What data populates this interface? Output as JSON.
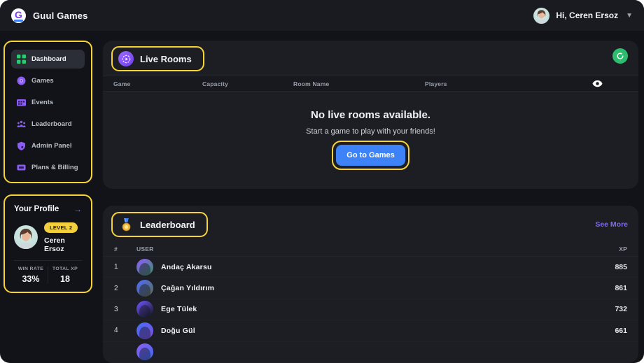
{
  "app": {
    "title": "Guul Games"
  },
  "header": {
    "greeting": "Hi, Ceren Ersoz"
  },
  "sidebar": {
    "items": [
      {
        "label": "Dashboard",
        "active": true
      },
      {
        "label": "Games",
        "active": false
      },
      {
        "label": "Events",
        "active": false
      },
      {
        "label": "Leaderboard",
        "active": false
      },
      {
        "label": "Admin Panel",
        "active": false
      },
      {
        "label": "Plans & Billing",
        "active": false
      }
    ]
  },
  "profile": {
    "title": "Your Profile",
    "level_badge": "LEVEL 2",
    "name": "Ceren Ersoz",
    "win_rate_label": "WIN RATE",
    "win_rate_value": "33%",
    "total_xp_label": "TOTAL XP",
    "total_xp_value": "18"
  },
  "live_rooms": {
    "title": "Live Rooms",
    "columns": {
      "game": "Game",
      "capacity": "Capacity",
      "room_name": "Room Name",
      "players": "Players"
    },
    "empty_title": "No live rooms available.",
    "empty_subtitle": "Start a game to play with your friends!",
    "cta_label": "Go to Games"
  },
  "leaderboard": {
    "title": "Leaderboard",
    "see_more": "See More",
    "columns": {
      "rank": "#",
      "user": "USER",
      "xp": "XP"
    },
    "rows": [
      {
        "rank": "1",
        "name": "Andaç Akarsu",
        "xp": "885"
      },
      {
        "rank": "2",
        "name": "Çağan Yıldırım",
        "xp": "861"
      },
      {
        "rank": "3",
        "name": "Ege Tülek",
        "xp": "732"
      },
      {
        "rank": "4",
        "name": "Doğu Gül",
        "xp": "661"
      },
      {
        "rank": "",
        "name": "",
        "xp": ""
      }
    ]
  },
  "colors": {
    "accent_purple": "#8b5cf6",
    "annotation_yellow": "#f8d337",
    "cta_blue": "#3d82f7",
    "refresh_green": "#2dbd6e",
    "badge_yellow": "#f2cf3d"
  }
}
